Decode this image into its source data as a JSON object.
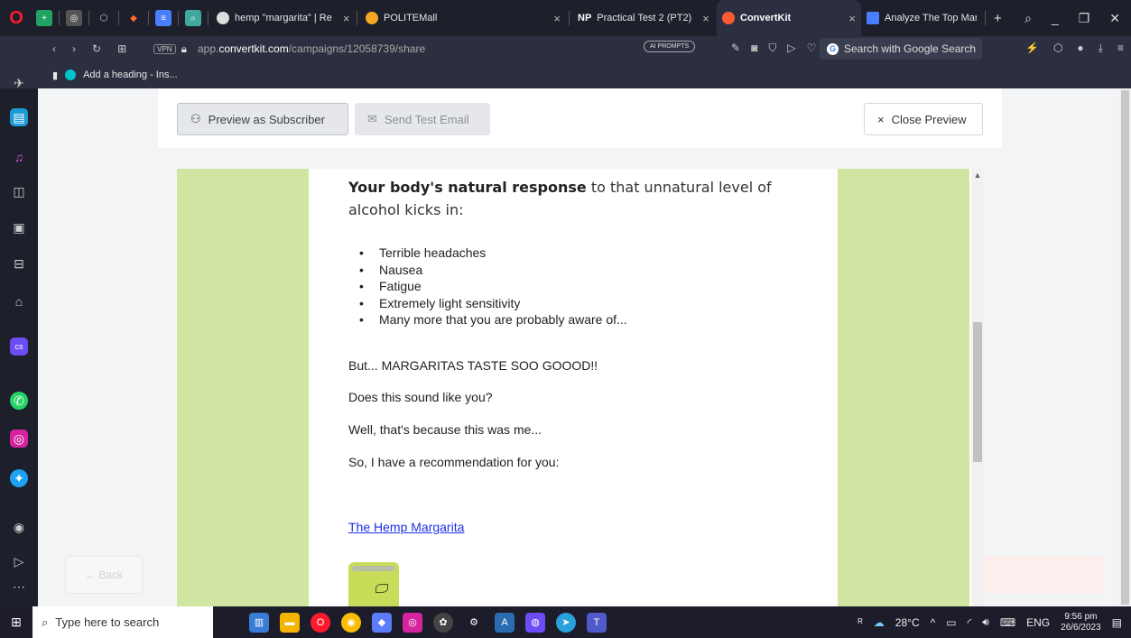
{
  "browser": {
    "tabs": [
      {
        "label": "hemp \"margarita\" | Re",
        "color": "#e0e0e0",
        "active": false
      },
      {
        "label": "POLITEMall",
        "color": "#f5a623",
        "active": false
      },
      {
        "label": "Practical Test 2 (PT2)",
        "prefix": "NP",
        "color": "#ffffff",
        "active": false
      },
      {
        "label": "ConvertKit",
        "color": "#ff5a36",
        "active": true
      },
      {
        "label": "Analyze The Top Marke",
        "color": "#4a7dff",
        "active": false
      }
    ],
    "url_prefix": "app.",
    "url_domain": "convertkit.com",
    "url_path": "/campaigns/12058739/share",
    "vpn": "VPN",
    "ai_prompts": "AI PROMPTS",
    "search_label": "Search with Google Search",
    "bookmark": "Add a heading - Ins..."
  },
  "preview": {
    "preview_subscriber": "Preview as Subscriber",
    "send_test": "Send Test Email",
    "close": "Close Preview",
    "back": "← Back"
  },
  "email": {
    "para1_bold": "Your body's natural response",
    "para1_rest": " to that unnatural level of alcohol kicks in:",
    "symptoms": [
      "Terrible headaches",
      "Nausea",
      "Fatigue",
      "Extremely light sensitivity",
      "Many more that you are probably aware of..."
    ],
    "line_margaritas": "But... MARGARITAS TASTE SOO GOOOD!!",
    "line_sound": "Does this sound like you?",
    "line_me": "Well, that's because this was me...",
    "line_recommend": "So, I have a recommendation for you:",
    "product_link": "The Hemp Margarita"
  },
  "taskbar": {
    "search_placeholder": "Type here to search",
    "weather": "28°C",
    "lang": "ENG",
    "time": "9:56 pm",
    "date": "26/6/2023"
  },
  "colors": {
    "accent_green": "#d1e5a3",
    "link_blue": "#1a2fe8",
    "opera_red": "#ff1b2d"
  }
}
